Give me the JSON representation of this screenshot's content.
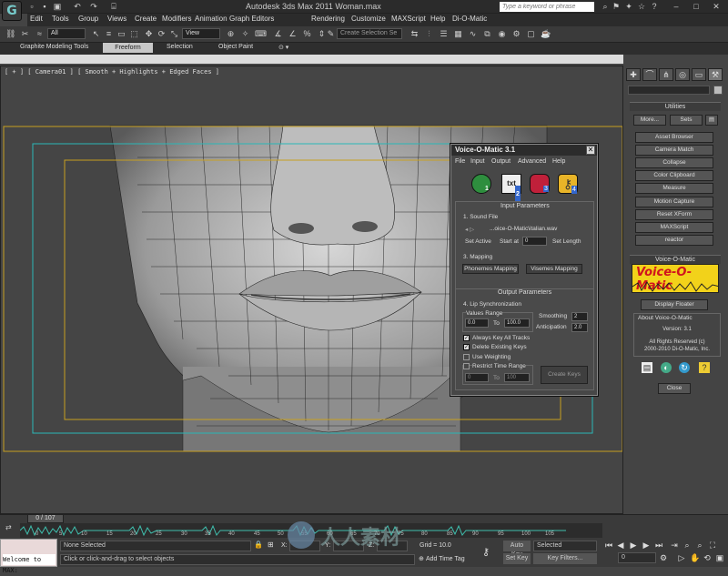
{
  "window": {
    "title": "Autodesk 3ds Max  2011      Woman.max",
    "search_placeholder": "Type a keyword or phrase"
  },
  "menubar": [
    "Edit",
    "Tools",
    "Group",
    "Views",
    "Create",
    "Modifiers",
    "Animation",
    "Graph Editors",
    "Rendering",
    "Customize",
    "MAXScript",
    "Help",
    "Di-O-Matic"
  ],
  "toolbar": {
    "filter": "All",
    "view": "View",
    "selection_set": "Create Selection Se"
  },
  "ribbon": {
    "tabs": [
      "Graphite Modeling Tools",
      "Freeform",
      "Selection",
      "Object Paint"
    ]
  },
  "viewport": {
    "label": "[ + ] [ Camera01 ] [ Smooth + Highlights + Edged Faces ]"
  },
  "command_panel": {
    "utilities_title": "Utilities",
    "more": "More...",
    "sets": "Sets",
    "items": [
      "Asset Browser",
      "Camera Match",
      "Collapse",
      "Color Clipboard",
      "Measure",
      "Motion Capture",
      "Reset XForm",
      "MAXScript",
      "reactor"
    ],
    "plugin_title": "Voice-O-Matic",
    "logo_text": "Voice-O-Matic",
    "display_floater": "Display Floater",
    "about": [
      "About Voice-O-Matic",
      "Version: 3.1",
      "All Rights Reserved (c)",
      "2000-2010 Di-O-Matic, Inc."
    ],
    "close": "Close"
  },
  "dialog": {
    "title": "Voice-O-Matic 3.1",
    "menu": [
      "File",
      "Input",
      "Output",
      "Advanced",
      "Help"
    ],
    "input_header": "Input Parameters",
    "sound_file_label": "1. Sound File",
    "sound_file": "...oice-O-Matic\\italian.wav",
    "set_active": "Set Active",
    "start_at": "Start at",
    "start_value": "0",
    "set_length": "Set Length",
    "mapping_label": "3. Mapping",
    "phonemes": "Phonemes Mapping",
    "visemes": "Visemes Mapping",
    "output_header": "Output Parameters",
    "lip_sync": "4. Lip Synchronization",
    "values_range": "Values Range",
    "range_from": "0.0",
    "to": "To",
    "range_to": "100.0",
    "smoothing": "Smoothing",
    "smoothing_value": "2",
    "anticipation": "Anticipation",
    "anticipation_value": "2.0",
    "always_key": "Always Key All Tracks",
    "delete_keys": "Delete Existing Keys",
    "use_weighting": "Use Weighting",
    "restrict_time": "Restrict Time Range",
    "rt_from": "0",
    "rt_to": "100",
    "create_keys": "Create Keys",
    "icon_numbers": [
      "1",
      "2",
      "3",
      "4"
    ]
  },
  "timeline": {
    "frame": "0 / 107",
    "ticks": [
      "0",
      "5",
      "10",
      "15",
      "20",
      "25",
      "30",
      "35",
      "40",
      "45",
      "50",
      "55",
      "60",
      "65",
      "70",
      "75",
      "80",
      "85",
      "90",
      "95",
      "100",
      "105"
    ]
  },
  "status": {
    "maxscript": "Welcome to MAX:",
    "selection": "None Selected",
    "prompt": "Click or click-and-drag to select objects",
    "grid": "Grid = 10.0",
    "add_time_tag": "Add Time Tag",
    "auto_key": "Auto Key",
    "set_key": "Set Key",
    "selected": "Selected",
    "key_filters": "Key Filters...",
    "frame_value": "0",
    "x_label": "X:",
    "y_label": "Y:",
    "z_label": "Z:"
  },
  "watermark": "人人素材"
}
